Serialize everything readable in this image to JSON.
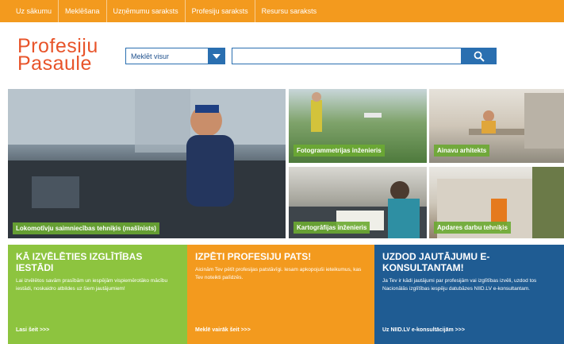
{
  "nav": {
    "items": [
      "Uz sākumu",
      "Meklēšana",
      "Uzņēmumu saraksts",
      "Profesiju saraksts",
      "Resursu saraksts"
    ]
  },
  "header": {
    "logo_line1": "Profesiju",
    "logo_line2": "Pasaule",
    "search_select": "Meklēt visur",
    "search_placeholder": ""
  },
  "tiles": {
    "main": "Lokomotīvju saimniecības tehniķis (mašīnists)",
    "foto": "Fotogrammetrijas inženieris",
    "ainavu": "Ainavu arhitekts",
    "karto": "Kartogrāfijas inženieris",
    "apdares": "Apdares darbu tehniķis"
  },
  "boxes": {
    "green": {
      "title": "Kā izvēlēties izglītības iestādi",
      "text": "Lai izvēlētos savām prasībām un iespējām vispiemērotāko mācību iestādi, noskaidro atbildes uz šiem jautājumiem!",
      "link": "Lasi šeit >>>"
    },
    "orange": {
      "title": "Izpēti profesiju pats!",
      "text": "Aicinām Tev pētīt profesijas patstāvīgi. Iesam apkopojuši ieteikumus, kas Tev noteikti palīdzēs.",
      "link": "Meklē vairāk šeit >>>"
    },
    "blue": {
      "title": "Uzdod jautājumu e-konsultantam!",
      "text": "Ja Tev ir kādi jautājumi par profesijām vai izglītības izvēli, uzdod tos Nacionālās izglītības iespēju datubāzes NIID.LV e-konsultantam.",
      "link": "Uz NIID.LV e-konsultācijām >>>"
    }
  },
  "colors": {
    "nav": "#f39a1e",
    "logo": "#e8542a",
    "blue": "#1f5c93",
    "green": "#8dc43f"
  }
}
